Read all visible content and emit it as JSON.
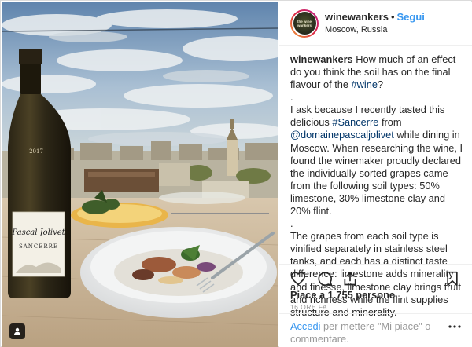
{
  "post": {
    "username": "winewankers",
    "separator": "•",
    "follow_label": "Segui",
    "location": "Moscow, Russia",
    "avatar_text": "the wine wankers",
    "bottle_year": "2017",
    "bottle_brand": "Pascal Jolivet",
    "bottle_name": "SANCERRE"
  },
  "caption": {
    "username": "winewankers",
    "line1_text": " How much of an effect do you think the soil has on the final flavour of the ",
    "hashtag_wine": "#wine",
    "line1_end": "?",
    "dot1": ".",
    "p2_start": "I ask because I recently tasted this delicious ",
    "hashtag_sancerre": "#Sancerre",
    "p2_from": " from ",
    "mention": "@domainepascaljolivet",
    "p2_rest": " while dining in Moscow. When researching the wine, I found the winemaker proudly declared the individually sorted grapes came from the following soil types: 50% limestone, 30% limestone clay and 20% flint.",
    "dot2": ".",
    "p3": "The grapes from each soil type is vinified separately in stainless steel tanks, and each has a distinct taste difference: limestone adds minerality and finesse, limestone clay brings fruit and richness while the flint supplies structure and minerality.",
    "dot3": "."
  },
  "actions": {
    "like_icon": "heart-icon",
    "comment_icon": "comment-icon",
    "share_icon": "share-icon",
    "save_icon": "bookmark-icon"
  },
  "likes_text": "Piace a 1.755 persone",
  "time_text": "16 ORE FA",
  "comment": {
    "login_link": "Accedi",
    "rest": " per mettere \"Mi piace\" o commentare."
  },
  "colors": {
    "link_blue": "#3897f0",
    "hashtag": "#003569",
    "muted": "#999999",
    "text": "#262626"
  }
}
